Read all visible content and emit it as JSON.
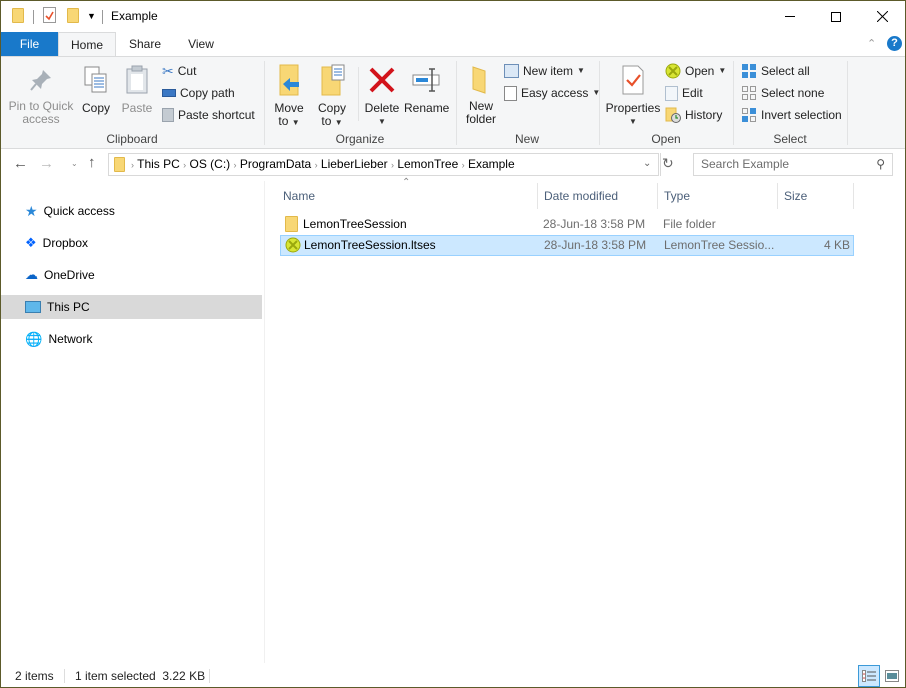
{
  "window": {
    "title": "Example",
    "controls": {
      "minimize": "minimize-icon",
      "maximize": "maximize-icon",
      "close": "close-icon"
    }
  },
  "quick_access_toolbar": {
    "icons": [
      "folder-icon",
      "properties-icon",
      "new-folder-icon",
      "customize-dropdown-icon"
    ]
  },
  "tabs": [
    {
      "label": "File",
      "active": false
    },
    {
      "label": "Home",
      "active": true
    },
    {
      "label": "Share",
      "active": false
    },
    {
      "label": "View",
      "active": false
    }
  ],
  "ribbon": {
    "collapse_icon": "chevron-up-icon",
    "help_icon": "help-icon",
    "groups": {
      "clipboard": {
        "label": "Clipboard",
        "pin": "Pin to Quick access",
        "pin_line1": "Pin to Quick",
        "pin_line2": "access",
        "copy": "Copy",
        "paste": "Paste",
        "cut": "Cut",
        "copy_path": "Copy path",
        "paste_shortcut": "Paste shortcut"
      },
      "organize": {
        "label": "Organize",
        "move_line1": "Move",
        "move_line2": "to",
        "copy_line1": "Copy",
        "copy_line2": "to",
        "delete": "Delete",
        "rename": "Rename"
      },
      "new": {
        "label": "New",
        "new_folder_line1": "New",
        "new_folder_line2": "folder",
        "new_item": "New item",
        "easy_access": "Easy access"
      },
      "open": {
        "label": "Open",
        "properties": "Properties",
        "open": "Open",
        "edit": "Edit",
        "history": "History"
      },
      "select": {
        "label": "Select",
        "select_all": "Select all",
        "select_none": "Select none",
        "invert_selection": "Invert selection"
      }
    }
  },
  "navigation": {
    "back_icon": "back-arrow-icon",
    "forward_icon": "forward-arrow-icon",
    "recent_icon": "recent-dropdown-icon",
    "up_icon": "up-arrow-icon"
  },
  "address_bar": {
    "breadcrumbs": [
      "This PC",
      "OS (C:)",
      "ProgramData",
      "LieberLieber",
      "LemonTree",
      "Example"
    ],
    "refresh_icon": "refresh-icon"
  },
  "search": {
    "placeholder": "Search Example"
  },
  "nav_pane": {
    "items": [
      {
        "label": "Quick access",
        "icon": "star-icon",
        "selected": false
      },
      {
        "label": "Dropbox",
        "icon": "dropbox-icon",
        "selected": false
      },
      {
        "label": "OneDrive",
        "icon": "cloud-icon",
        "selected": false
      },
      {
        "label": "This PC",
        "icon": "computer-icon",
        "selected": true
      },
      {
        "label": "Network",
        "icon": "network-icon",
        "selected": false
      }
    ]
  },
  "file_list": {
    "columns": [
      "Name",
      "Date modified",
      "Type",
      "Size"
    ],
    "sort_column": "Name",
    "rows": [
      {
        "name": "LemonTreeSession",
        "date": "28-Jun-18 3:58 PM",
        "type": "File folder",
        "size": "",
        "icon": "folder-icon",
        "selected": false
      },
      {
        "name": "LemonTreeSession.ltses",
        "date": "28-Jun-18 3:58 PM",
        "type": "LemonTree Sessio...",
        "size": "4 KB",
        "icon": "lemontree-file-icon",
        "selected": true
      }
    ]
  },
  "status_bar": {
    "item_count": "2 items",
    "selection": "1 item selected  3.22 KB",
    "views": [
      {
        "name": "details-view",
        "active": true
      },
      {
        "name": "large-icons-view",
        "active": false
      }
    ]
  },
  "colors": {
    "accent": "#1979ca",
    "selection_bg": "#cce8ff",
    "selection_border": "#99d1ff",
    "nav_selected": "#d9d9d9",
    "window_border": "#5c5a2a"
  }
}
